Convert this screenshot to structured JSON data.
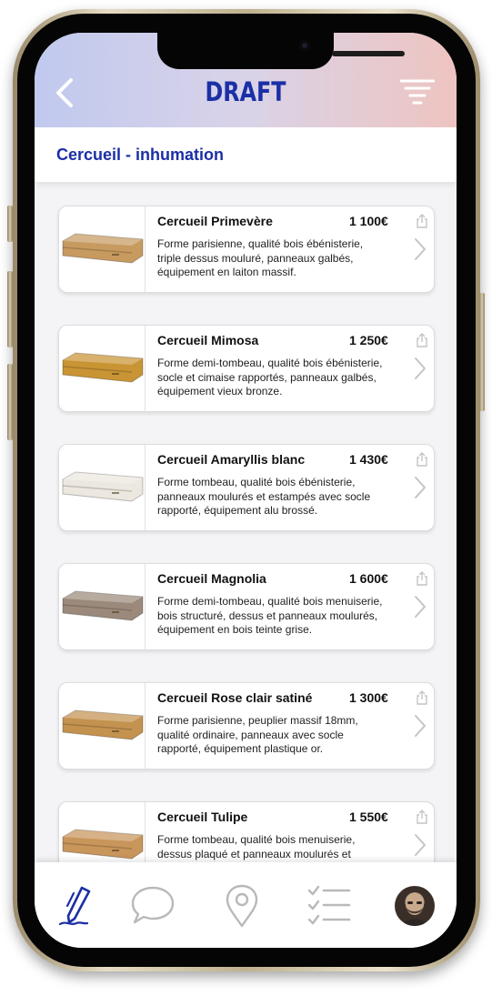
{
  "header": {
    "title": "DRAFT",
    "back_icon": "chevron-left-icon",
    "filter_icon": "filter-lines-icon"
  },
  "category": {
    "title": "Cercueil - inhumation"
  },
  "colors": {
    "brand": "#1b2fa6",
    "header_left": "#c0c9ee",
    "header_right": "#eec4c0"
  },
  "products": [
    {
      "name": "Cercueil Primevère",
      "price": "1 100€",
      "description": "Forme parisienne, qualité bois ébénisterie, triple dessus mouluré, panneaux galbés, équipement en laiton massif.",
      "wood": "#c79a60"
    },
    {
      "name": "Cercueil Mimosa",
      "price": "1 250€",
      "description": "Forme demi-tombeau, qualité bois ébénisterie, socle et cimaise rapportés, panneaux galbés, équipement vieux bronze.",
      "wood": "#c99434"
    },
    {
      "name": "Cercueil Amaryllis blanc",
      "price": "1 430€",
      "description": "Forme tombeau, qualité bois ébénisterie, panneaux moulurés et estampés avec socle rapporté, équipement alu brossé.",
      "wood": "#ece8df"
    },
    {
      "name": "Cercueil Magnolia",
      "price": "1 600€",
      "description": "Forme demi-tombeau, qualité bois menuiserie, bois structuré, dessus et panneaux moulurés, équipement en bois teinte grise.",
      "wood": "#9b8a7b"
    },
    {
      "name": "Cercueil Rose clair satiné",
      "price": "1 300€",
      "description": "Forme parisienne, peuplier massif 18mm, qualité ordinaire, panneaux avec socle rapporté, équipement plastique or.",
      "wood": "#c4924f"
    },
    {
      "name": "Cercueil Tulipe",
      "price": "1 550€",
      "description": "Forme tombeau, qualité bois menuiserie, dessus plaqué et panneaux moulurés et estampés avec",
      "wood": "#c8955a"
    }
  ],
  "tabs": [
    {
      "icon": "pen-icon",
      "active": true
    },
    {
      "icon": "chat-bubble-icon",
      "active": false
    },
    {
      "icon": "map-pin-icon",
      "active": false
    },
    {
      "icon": "checklist-icon",
      "active": false
    },
    {
      "icon": "profile-avatar",
      "active": false
    }
  ]
}
